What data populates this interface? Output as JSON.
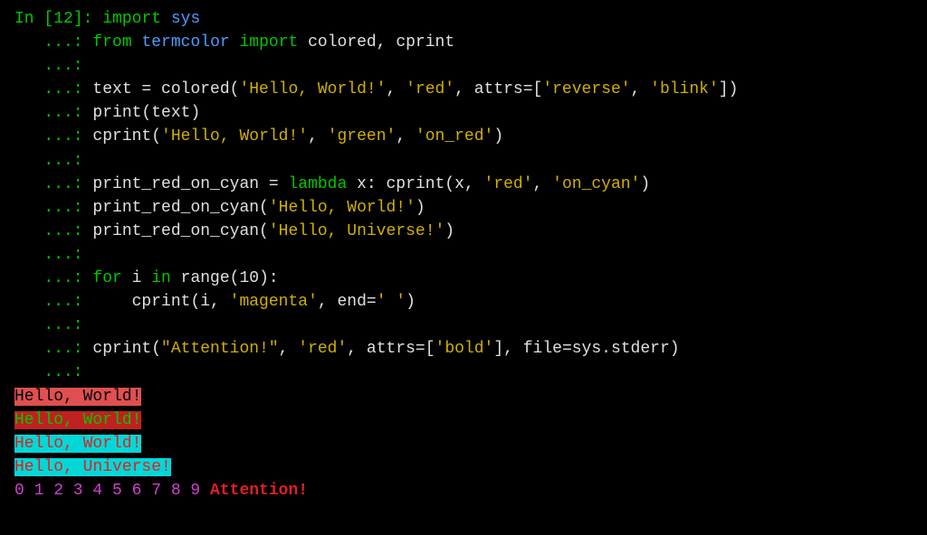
{
  "cell_number": "12",
  "code": {
    "l1": {
      "import": "import",
      "sys": "sys"
    },
    "l2": {
      "from": "from",
      "termcolor": "termcolor",
      "import": "import",
      "rest": "colored, cprint"
    },
    "l4a": "text = colored(",
    "l4s1": "'Hello, World!'",
    "l4b": ", ",
    "l4s2": "'red'",
    "l4c": ", attrs=[",
    "l4s3": "'reverse'",
    "l4d": ", ",
    "l4s4": "'blink'",
    "l4e": "])",
    "l5": "print(text)",
    "l6a": "cprint(",
    "l6s1": "'Hello, World!'",
    "l6b": ", ",
    "l6s2": "'green'",
    "l6c": ", ",
    "l6s3": "'on_red'",
    "l6d": ")",
    "l8a": "print_red_on_cyan = ",
    "l8kw": "lambda",
    "l8b": " x: cprint(x, ",
    "l8s1": "'red'",
    "l8c": ", ",
    "l8s2": "'on_cyan'",
    "l8d": ")",
    "l9a": "print_red_on_cyan(",
    "l9s1": "'Hello, World!'",
    "l9b": ")",
    "l10a": "print_red_on_cyan(",
    "l10s1": "'Hello, Universe!'",
    "l10b": ")",
    "l12for": "for",
    "l12a": " i ",
    "l12in": "in",
    "l12b": " range(",
    "l12n": "10",
    "l12c": "):",
    "l13a": "    cprint(i, ",
    "l13s1": "'magenta'",
    "l13b": ", end=",
    "l13s2": "' '",
    "l13c": ")",
    "l15a": "cprint(",
    "l15s1": "\"Attention!\"",
    "l15b": ", ",
    "l15s2": "'red'",
    "l15c": ", attrs=[",
    "l15s3": "'bold'",
    "l15d": "], file=sys.stderr)"
  },
  "output": {
    "o1": "Hello, World!",
    "o2": "Hello, World!",
    "o3": "Hello, World!",
    "o4": "Hello, Universe!",
    "nums": [
      "0",
      "1",
      "2",
      "3",
      "4",
      "5",
      "6",
      "7",
      "8",
      "9"
    ],
    "attn": "Attention!"
  },
  "prompt": {
    "in_prefix": "In [",
    "in_suffix": "]: ",
    "cont": "   ...: "
  }
}
